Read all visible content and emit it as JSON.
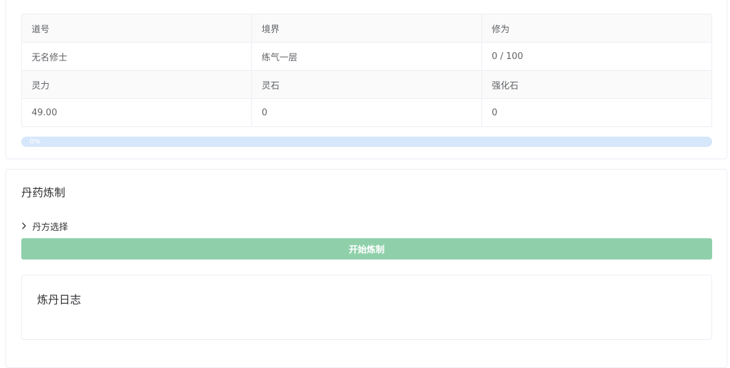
{
  "stats": {
    "rows": [
      [
        "道号",
        "境界",
        "修为"
      ],
      [
        "无名修士",
        "练气一层",
        "0 / 100"
      ],
      [
        "灵力",
        "灵石",
        "强化石"
      ],
      [
        "49.00",
        "0",
        "0"
      ]
    ]
  },
  "progress": {
    "percent": 0,
    "label": "0%",
    "color_track": "#d6e7fb",
    "color_fill": "#409eff"
  },
  "alchemy": {
    "title": "丹药炼制",
    "recipe_label": "丹方选择",
    "recipe_icon": "chevron-right-icon",
    "start_button": "开始炼制",
    "button_color": "#8fd0aa",
    "log_title": "炼丹日志"
  }
}
